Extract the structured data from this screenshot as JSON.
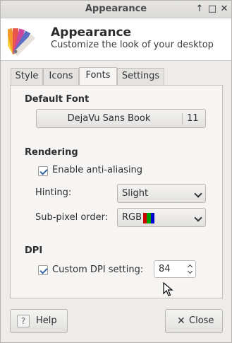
{
  "window": {
    "title": "Appearance"
  },
  "titlebar_buttons": [
    {
      "icon": "arrow-up-icon",
      "glyph": "↑"
    },
    {
      "icon": "maximize-icon",
      "glyph": "□"
    },
    {
      "icon": "close-icon",
      "glyph": "✕"
    }
  ],
  "header": {
    "title": "Appearance",
    "subtitle": "Customize the look of your desktop",
    "icon": "color-swatches-icon"
  },
  "tabs": [
    {
      "label": "Style",
      "active": false
    },
    {
      "label": "Icons",
      "active": false
    },
    {
      "label": "Fonts",
      "active": true
    },
    {
      "label": "Settings",
      "active": false
    }
  ],
  "default_font": {
    "section_label": "Default Font",
    "font_name": "DejaVu Sans Book",
    "font_size": "11"
  },
  "rendering": {
    "section_label": "Rendering",
    "antialias_label": "Enable anti-aliasing",
    "antialias_checked": true,
    "hinting_label": "Hinting:",
    "hinting_value": "Slight",
    "subpixel_label": "Sub-pixel order:",
    "subpixel_value": "RGB",
    "subpixel_colors": [
      "#d00000",
      "#00a000",
      "#0000d0"
    ]
  },
  "dpi": {
    "section_label": "DPI",
    "custom_label": "Custom DPI setting:",
    "custom_checked": true,
    "value": "84"
  },
  "footer": {
    "help_label": "Help",
    "help_icon": "?",
    "close_label": "Close",
    "close_icon": "✕"
  },
  "colors": {
    "accent": "#3465a4",
    "window_bg": "#edecea"
  }
}
